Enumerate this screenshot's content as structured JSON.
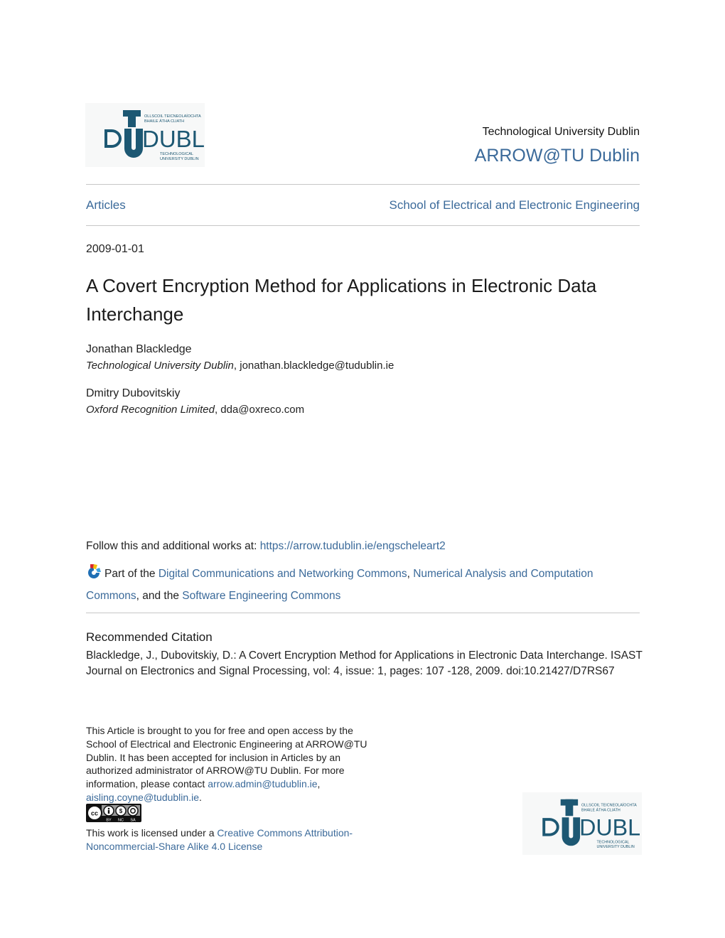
{
  "header": {
    "logo_top": {
      "big_text": "DUBLIN",
      "t_letter": "T",
      "irish_line1": "OLLSCOIL TEICNEOLAÍOCHTA",
      "irish_line2": "BHAILE ÁTHA CLIATH",
      "english_line1": "TECHNOLOGICAL",
      "english_line2": "UNIVERSITY DUBLIN"
    },
    "institution": "Technological University Dublin",
    "repository": "ARROW@TU Dublin"
  },
  "nav": {
    "collection": "Articles",
    "department": "School of Electrical and Electronic Engineering"
  },
  "article": {
    "date": "2009-01-01",
    "title": "A Covert Encryption Method for Applications in Electronic Data Interchange",
    "authors": [
      {
        "name": "Jonathan Blackledge",
        "affiliation": "Technological University Dublin",
        "email": "jonathan.blackledge@tudublin.ie"
      },
      {
        "name": "Dmitry Dubovitskiy",
        "affiliation": "Oxford Recognition Limited",
        "email": "dda@oxreco.com"
      }
    ]
  },
  "follow": {
    "label": "Follow this and additional works at: ",
    "url": "https://arrow.tudublin.ie/engscheleart2"
  },
  "part_of": {
    "prefix": "Part of the ",
    "commons": [
      "Digital Communications and Networking Commons",
      "Numerical Analysis and Computation Commons",
      "Software Engineering Commons"
    ],
    "sep1": ", ",
    "sep2": ", and the "
  },
  "citation": {
    "heading": "Recommended Citation",
    "text": "Blackledge, J., Dubovitskiy, D.: A Covert Encryption Method for Applications in Electronic Data Interchange. ISAST Journal on Electronics and Signal Processing, vol: 4, issue: 1, pages: 107 -128, 2009. doi:10.21427/D7RS67"
  },
  "access_note": {
    "text": "This Article is brought to you for free and open access by the School of Electrical and Electronic Engineering at ARROW@TU Dublin. It has been accepted for inclusion in Articles by an authorized administrator of ARROW@TU Dublin. For more information, please contact ",
    "emails": [
      "arrow.admin@tudublin.ie",
      "aisling.coyne@tudublin.ie"
    ],
    "email_sep": ", ",
    "end": "."
  },
  "license": {
    "badge_labels": [
      "BY",
      "NC",
      "SA"
    ],
    "prefix": "This work is licensed under a ",
    "link": "Creative Commons Attribution-Noncommercial-Share Alike 4.0 License"
  },
  "colors": {
    "link": "#3b6a9a",
    "logo": "#1d5873",
    "rule": "#c7c7c7"
  }
}
